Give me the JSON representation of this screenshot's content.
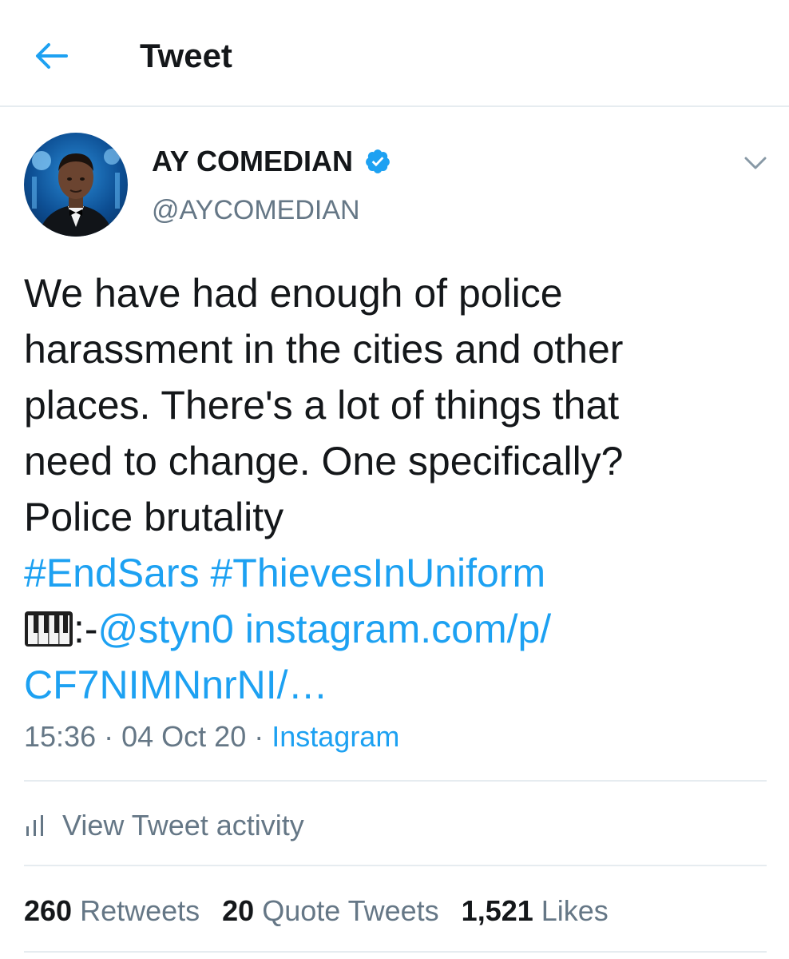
{
  "header": {
    "title": "Tweet",
    "back_icon": "arrow-left-icon"
  },
  "author": {
    "display_name": "AY COMEDIAN",
    "handle": "@AYCOMEDIAN",
    "verified": true,
    "verified_icon": "verified-badge-icon"
  },
  "tweet": {
    "text_lines": [
      "We have had enough of police",
      "harassment in the cities and other",
      "places. There's a lot of things that",
      "need to change. One specifically?",
      "Police brutality"
    ],
    "hashtags": [
      "#EndSars",
      "#ThievesInUniform"
    ],
    "piano_icon": "piano-keyboard-icon",
    "credit_separator": ":-",
    "mention": "@styn0",
    "url_part1": "instagram.com/p/",
    "url_part2": "CF7NIMNnrNI/…"
  },
  "meta": {
    "time": "15:36",
    "date": "04 Oct 20",
    "separator": "·",
    "source": "Instagram"
  },
  "activity": {
    "label": "View Tweet activity",
    "icon": "bar-chart-icon"
  },
  "stats": {
    "retweets_count": "260",
    "retweets_label": "Retweets",
    "quote_count": "20",
    "quote_label": "Quote Tweets",
    "likes_count": "1,521",
    "likes_label": "Likes"
  },
  "colors": {
    "accent": "#1da1f2",
    "text_primary": "#14171a",
    "text_secondary": "#657786",
    "divider": "#e6ecf0"
  }
}
